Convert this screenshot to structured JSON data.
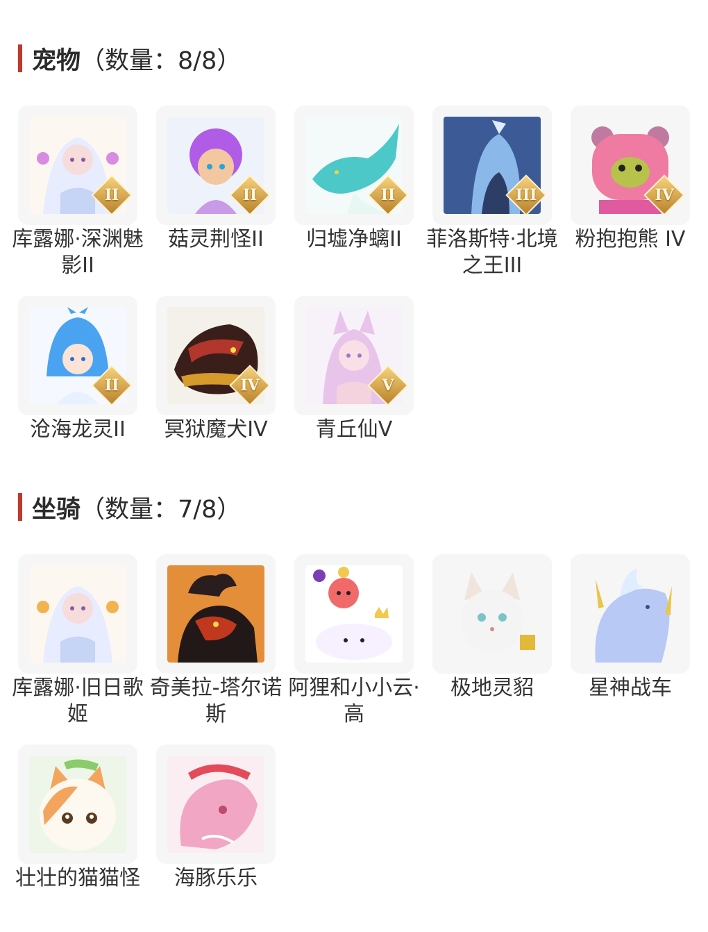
{
  "sections": [
    {
      "title": "宠物",
      "count": "（数量：8/8）",
      "items": [
        {
          "label": "库露娜·深渊魅影II",
          "rank": "II",
          "art": "girl-white",
          "hair": "#e8ecff",
          "accent": "#d88ce0"
        },
        {
          "label": "菇灵荆怪II",
          "rank": "II",
          "art": "chibi-purple",
          "hair": "#b05ce6",
          "accent": "#f3c7a0"
        },
        {
          "label": "归墟净螭II",
          "rank": "II",
          "art": "dragon-teal",
          "hair": "#4cc8c8",
          "accent": "#e8f6f4"
        },
        {
          "label": "菲洛斯特·北境之王III",
          "rank": "III",
          "art": "knight-ice",
          "hair": "#8ab8e8",
          "accent": "#2c3e66"
        },
        {
          "label": "粉抱抱熊 IV",
          "rank": "IV",
          "art": "bear-pink",
          "hair": "#ef7aa2",
          "accent": "#b6c24a"
        },
        {
          "label": "沧海龙灵II",
          "rank": "II",
          "art": "boy-blue",
          "hair": "#4aa3f0",
          "accent": "#e8f1ff"
        },
        {
          "label": "冥狱魔犬IV",
          "rank": "IV",
          "art": "hound-dark",
          "hair": "#3a1e1a",
          "accent": "#d59a2c"
        },
        {
          "label": "青丘仙V",
          "rank": "V",
          "art": "fox-girl",
          "hair": "#e9c4ea",
          "accent": "#9a7ad0"
        }
      ]
    },
    {
      "title": "坐骑",
      "count": "（数量：7/8）",
      "items": [
        {
          "label": "库露娜·旧日歌姬",
          "rank": "",
          "art": "girl-white",
          "hair": "#e8ecff",
          "accent": "#f2b34e"
        },
        {
          "label": "奇美拉-塔尔诺斯",
          "rank": "",
          "art": "chimera",
          "hair": "#2a1d1d",
          "accent": "#c0391e"
        },
        {
          "label": "阿狸和小小云·高",
          "rank": "",
          "art": "ali-cloud",
          "hair": "#f06a6a",
          "accent": "#ffffff"
        },
        {
          "label": "极地灵貂",
          "rank": "",
          "art": "ferret-white",
          "hair": "#f4f4f4",
          "accent": "#7cc3c7"
        },
        {
          "label": "星神战车",
          "rank": "",
          "art": "horse-crystal",
          "hair": "#b9c9f6",
          "accent": "#e8c64a"
        },
        {
          "label": "壮壮的猫猫怪",
          "rank": "",
          "art": "cat-calico",
          "hair": "#f3a55e",
          "accent": "#8acb6a"
        },
        {
          "label": "海豚乐乐",
          "rank": "",
          "art": "dolphin-pink",
          "hair": "#f1a6c4",
          "accent": "#e34a5a"
        }
      ]
    }
  ],
  "colors": {
    "accent_bar": "#c0392b",
    "card_bg": "#f6f6f6",
    "text": "#333333"
  }
}
